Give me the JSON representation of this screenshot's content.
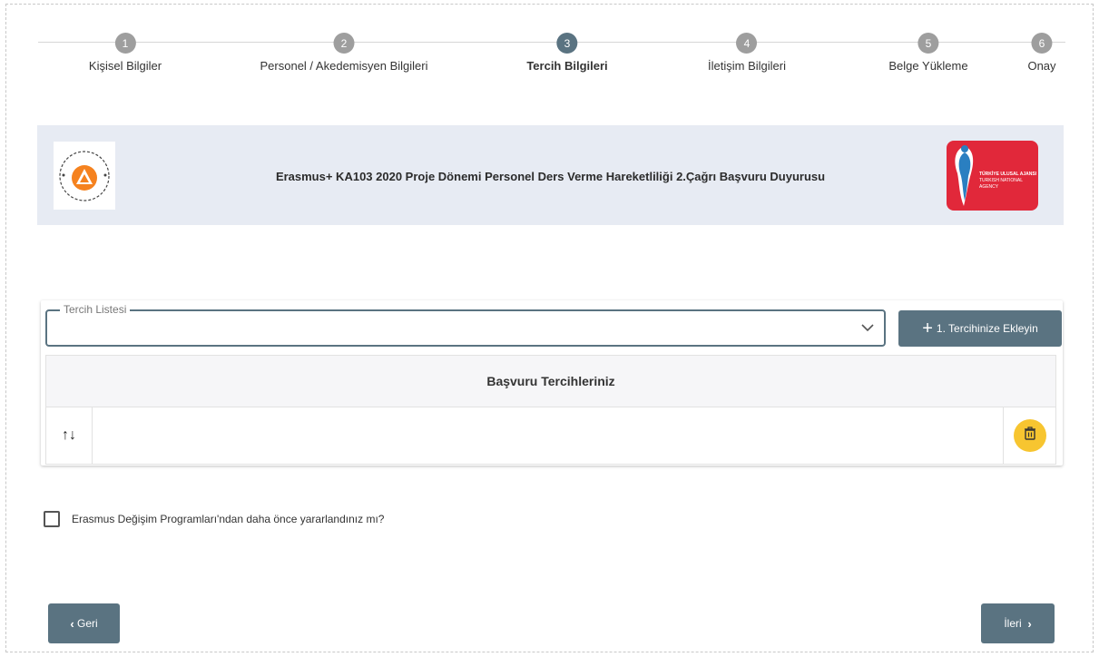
{
  "stepper": {
    "steps": [
      {
        "number": "1",
        "label": "Kişisel Bilgiler"
      },
      {
        "number": "2",
        "label": "Personel / Akedemisyen Bilgileri"
      },
      {
        "number": "3",
        "label": "Tercih Bilgileri"
      },
      {
        "number": "4",
        "label": "İletişim Bilgileri"
      },
      {
        "number": "5",
        "label": "Belge Yükleme"
      },
      {
        "number": "6",
        "label": "Onay"
      }
    ],
    "active_step": "3"
  },
  "banner": {
    "title": "Erasmus+ KA103 2020 Proje Dönemi Personel Ders Verme Hareketliliği 2.Çağrı Başvuru Duyurusu",
    "left_logo": "izmir-ekonomi-universitesi-logo",
    "right_logo": "turkiye-ulusal-ajansi-logo",
    "right_logo_text_1": "TÜRKİYE ULUSAL AJANSI",
    "right_logo_text_2": "TURKISH NATIONAL AGENCY"
  },
  "preferences": {
    "select_legend": "Tercih Listesi",
    "select_value": "",
    "add_button_label": "1. Tercihinize Ekleyin",
    "table_header": "Başvuru Tercihleriniz",
    "sort_icon": "↑↓"
  },
  "previous_participation": {
    "label": "Erasmus Değişim Programları'ndan daha önce yararlandınız mı?",
    "checked": false
  },
  "navigation": {
    "back_label": "Geri",
    "next_label": "İleri"
  },
  "colors": {
    "primary": "#5a7381",
    "inactive_step": "#9e9e9e",
    "banner_bg": "#e7ebf3",
    "delete_button": "#f7c530",
    "agency_red": "#e1283a"
  }
}
